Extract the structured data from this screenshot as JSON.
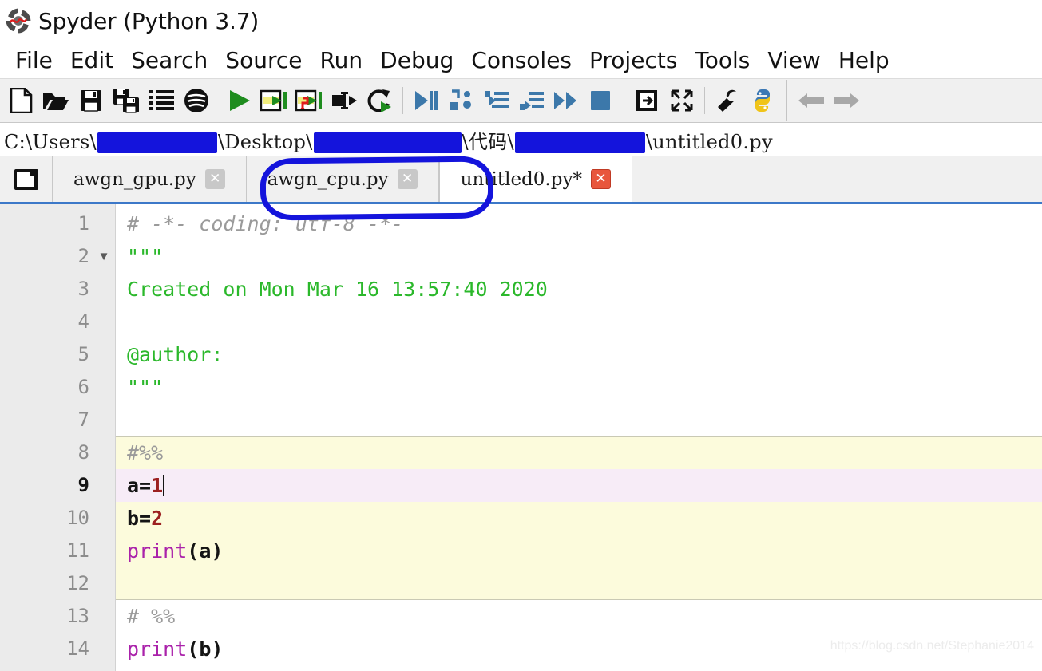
{
  "window": {
    "title": "Spyder (Python 3.7)",
    "logo_icon": "spyder-logo-icon"
  },
  "menubar": {
    "items": [
      {
        "label": "File"
      },
      {
        "label": "Edit"
      },
      {
        "label": "Search"
      },
      {
        "label": "Source"
      },
      {
        "label": "Run"
      },
      {
        "label": "Debug"
      },
      {
        "label": "Consoles"
      },
      {
        "label": "Projects"
      },
      {
        "label": "Tools"
      },
      {
        "label": "View"
      },
      {
        "label": "Help"
      }
    ]
  },
  "toolbar": {
    "annotation": {
      "shape": "rounded-rectangle",
      "color": "#1414dc",
      "encircles": "run-file, run-cell, run-cell-and-advance, run-selection, re-run-last-cell"
    },
    "buttons": [
      {
        "name": "new-file-icon",
        "tooltip": "New file"
      },
      {
        "name": "open-file-icon",
        "tooltip": "Open file"
      },
      {
        "name": "save-file-icon",
        "tooltip": "Save file"
      },
      {
        "name": "save-all-icon",
        "tooltip": "Save all"
      },
      {
        "name": "file-switcher-icon",
        "tooltip": "File switcher"
      },
      {
        "name": "find-symbol-icon",
        "tooltip": "Symbol finder"
      },
      {
        "name": "run-file-icon",
        "tooltip": "Run file"
      },
      {
        "name": "run-cell-icon",
        "tooltip": "Run current cell"
      },
      {
        "name": "run-cell-and-advance-icon",
        "tooltip": "Run current cell and go to the next one"
      },
      {
        "name": "run-selection-icon",
        "tooltip": "Run selection or current line"
      },
      {
        "name": "re-run-last-cell-icon",
        "tooltip": "Re-run last cell"
      },
      {
        "name": "debug-file-icon",
        "tooltip": "Debug file"
      },
      {
        "name": "step-over-icon",
        "tooltip": "Run current line"
      },
      {
        "name": "step-into-icon",
        "tooltip": "Step into function"
      },
      {
        "name": "step-return-icon",
        "tooltip": "Run until function returns"
      },
      {
        "name": "continue-icon",
        "tooltip": "Continue execution"
      },
      {
        "name": "stop-debug-icon",
        "tooltip": "Stop debugging"
      },
      {
        "name": "maximize-pane-icon",
        "tooltip": "Maximize current pane"
      },
      {
        "name": "fullscreen-icon",
        "tooltip": "Fullscreen mode"
      },
      {
        "name": "preferences-icon",
        "tooltip": "Preferences"
      },
      {
        "name": "pythonpath-manager-icon",
        "tooltip": "PYTHONPATH manager"
      },
      {
        "name": "back-icon",
        "tooltip": "Back"
      },
      {
        "name": "forward-icon",
        "tooltip": "Forward"
      }
    ]
  },
  "pathbar": {
    "segments": [
      {
        "type": "text",
        "value": "C:\\Users\\"
      },
      {
        "type": "redact",
        "width": 150
      },
      {
        "type": "text",
        "value": "\\Desktop\\"
      },
      {
        "type": "redact",
        "width": 185
      },
      {
        "type": "text",
        "value": "\\代码\\"
      },
      {
        "type": "redact",
        "width": 163
      },
      {
        "type": "text",
        "value": "\\untitled0.py"
      }
    ],
    "full_text_visible": "C:\\Users\\     \\Desktop\\     \\代码\\     \\untitled0.py"
  },
  "tabbar": {
    "browse_icon": "browse-tabs-icon",
    "tabs": [
      {
        "label": "awgn_gpu.py",
        "active": false,
        "modified": false,
        "close_icon": "close-icon"
      },
      {
        "label": "awgn_cpu.py",
        "active": false,
        "modified": false,
        "close_icon": "close-icon"
      },
      {
        "label": "untitled0.py*",
        "active": true,
        "modified": true,
        "close_icon": "close-icon"
      }
    ]
  },
  "editor": {
    "current_line": 9,
    "cell_highlight_lines": [
      8,
      12
    ],
    "lines": [
      {
        "num": "1",
        "fold": false,
        "tokens": [
          {
            "t": "comment",
            "v": "# -*- coding: utf-8 -*-"
          }
        ]
      },
      {
        "num": "2",
        "fold": true,
        "tokens": [
          {
            "t": "string",
            "v": "\"\"\""
          }
        ]
      },
      {
        "num": "3",
        "fold": false,
        "tokens": [
          {
            "t": "string",
            "v": "Created on Mon Mar 16 13:57:40 2020"
          }
        ]
      },
      {
        "num": "4",
        "fold": false,
        "tokens": [
          {
            "t": "string",
            "v": ""
          }
        ]
      },
      {
        "num": "5",
        "fold": false,
        "tokens": [
          {
            "t": "string",
            "v": "@author:"
          }
        ]
      },
      {
        "num": "6",
        "fold": false,
        "tokens": [
          {
            "t": "string",
            "v": "\"\"\""
          }
        ]
      },
      {
        "num": "7",
        "fold": false,
        "tokens": [
          {
            "t": "plain",
            "v": ""
          }
        ]
      },
      {
        "num": "8",
        "fold": false,
        "tokens": [
          {
            "t": "comment",
            "v": "#%%"
          }
        ]
      },
      {
        "num": "9",
        "fold": false,
        "tokens": [
          {
            "t": "plain",
            "v": "a="
          },
          {
            "t": "number",
            "v": "1"
          }
        ],
        "caret": true
      },
      {
        "num": "10",
        "fold": false,
        "tokens": [
          {
            "t": "plain",
            "v": "b="
          },
          {
            "t": "number",
            "v": "2"
          }
        ]
      },
      {
        "num": "11",
        "fold": false,
        "tokens": [
          {
            "t": "builtin",
            "v": "print"
          },
          {
            "t": "plain",
            "v": "(a)"
          }
        ]
      },
      {
        "num": "12",
        "fold": false,
        "tokens": [
          {
            "t": "plain",
            "v": ""
          }
        ]
      },
      {
        "num": "13",
        "fold": false,
        "tokens": [
          {
            "t": "comment",
            "v": "# %%"
          }
        ]
      },
      {
        "num": "14",
        "fold": false,
        "tokens": [
          {
            "t": "builtin",
            "v": "print"
          },
          {
            "t": "plain",
            "v": "(b)"
          }
        ]
      }
    ]
  },
  "watermark": {
    "text": "https://blog.csdn.net/Stephanie2014"
  },
  "colors": {
    "annotation_blue": "#1414dc",
    "redaction_blue": "#1414dc",
    "cell_background": "#fcfbdc",
    "current_line_background": "#f7ecf7",
    "string_green": "#2bb82b",
    "comment_gray": "#9a9a9a",
    "builtin_purple": "#aa22aa",
    "number_red": "#9c2020",
    "tab_active_close": "#e8563c",
    "tabbar_underline": "#3c78c8",
    "run_green": "#1e8c1e",
    "debug_blue": "#3c78aa"
  }
}
